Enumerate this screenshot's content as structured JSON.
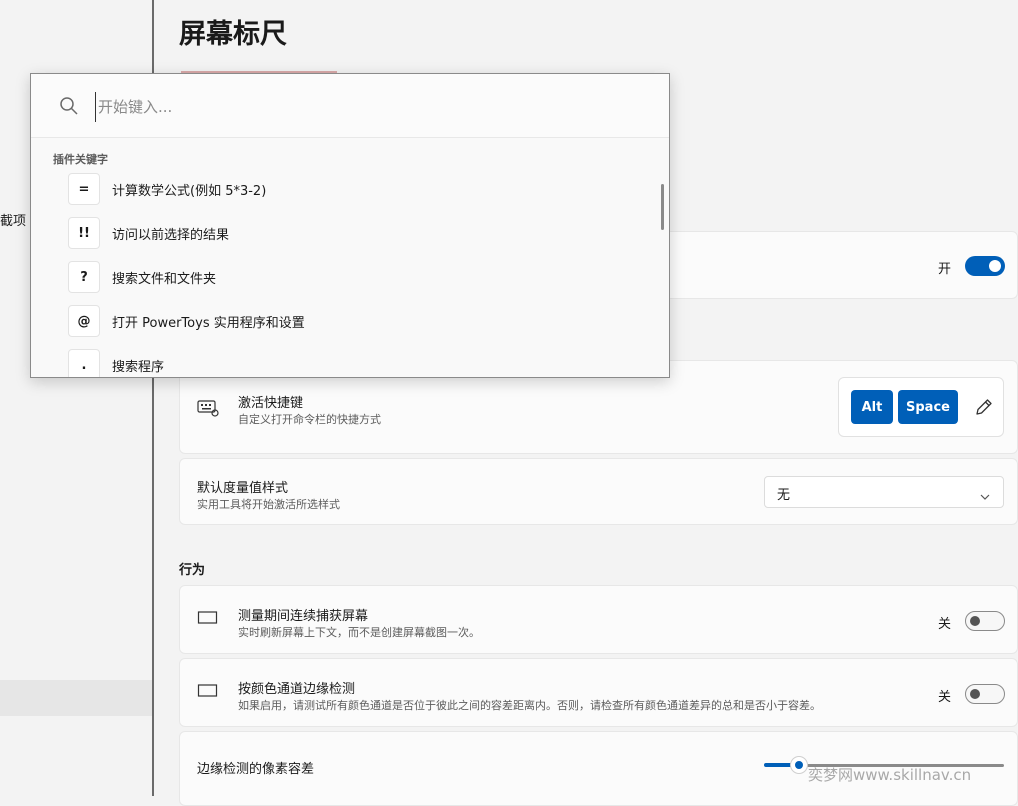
{
  "page": {
    "title": "屏幕标尺"
  },
  "sidebar": {
    "partial_item": "截项"
  },
  "cards": {
    "enable": {
      "toggle_label": "开"
    },
    "activation_shortcut": {
      "title": "激活快捷键",
      "description": "自定义打开命令栏的快捷方式",
      "keys": [
        "Alt",
        "Space"
      ],
      "icon": "keyboard-icon"
    },
    "default_style": {
      "title": "默认度量值样式",
      "description": "实用工具将开始激活所选样式",
      "selected": "无"
    }
  },
  "behavior": {
    "header": "行为",
    "continuous_capture": {
      "title": "测量期间连续捕获屏幕",
      "description": "实时刷新屏幕上下文，而不是创建屏幕截图一次。",
      "toggle_label": "关"
    },
    "per_channel": {
      "title": "按颜色通道边缘检测",
      "description": "如果启用，请测试所有颜色通道是否位于彼此之间的容差距离内。否则，请检查所有颜色通道差异的总和是否小于容差。",
      "toggle_label": "关"
    },
    "pixel_tolerance": {
      "title": "边缘检测的像素容差",
      "slider_fraction": 0.15
    }
  },
  "popup": {
    "search_placeholder": "开始键入...",
    "section_label": "插件关键字",
    "items": [
      {
        "key": "=",
        "desc": "计算数学公式(例如 5*3-2)"
      },
      {
        "key": "!!",
        "desc": "访问以前选择的结果"
      },
      {
        "key": "?",
        "desc": "搜索文件和文件夹"
      },
      {
        "key": "@",
        "desc": "打开 PowerToys 实用程序和设置"
      },
      {
        "key": ".",
        "desc": "搜索程序"
      }
    ]
  },
  "watermark": "奕梦网www.skillnav.cn",
  "colors": {
    "accent": "#005fb8",
    "background": "#f3f3f3",
    "card": "#fbfbfb"
  }
}
